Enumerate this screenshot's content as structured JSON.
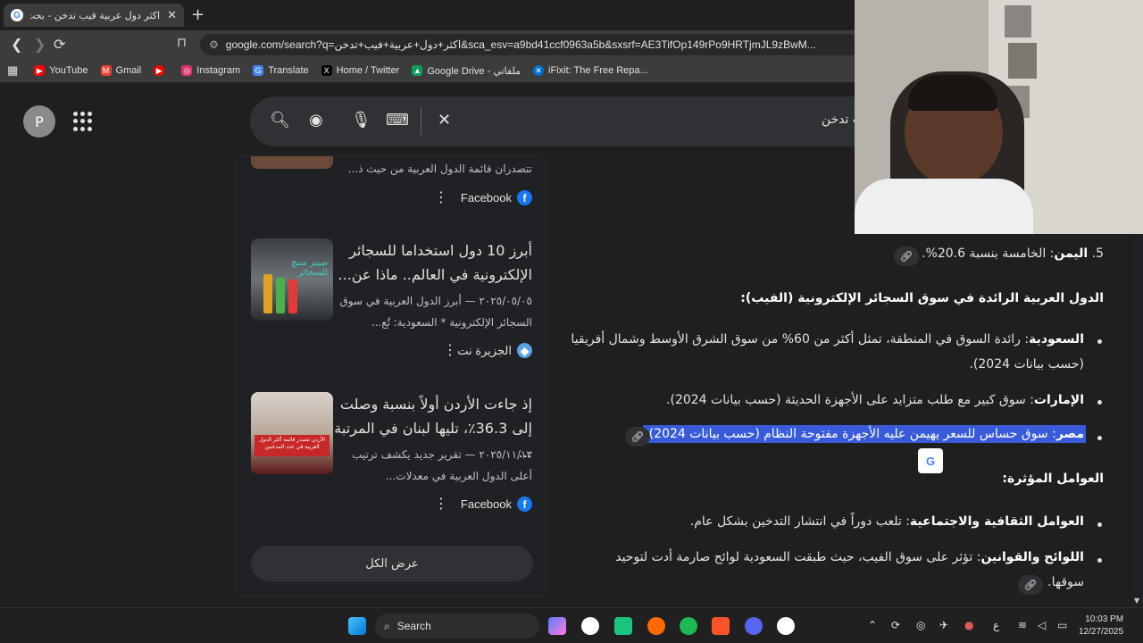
{
  "browser": {
    "tab_title": "اكثر دول عربية فيب تدخن - بحث Google",
    "address": "google.com/search?q=اكثر+دول+عربية+فيب+تدخن&sca_esv=a9bd41ccf0963a5b&sxsrf=AE3TifOp149rPo9HRTjmJL9zBwM..."
  },
  "bookmarks": [
    {
      "label": "YouTube",
      "icon": "youtube-icon",
      "color": "#ff0000"
    },
    {
      "label": "Gmail",
      "icon": "gmail-icon",
      "color": "#ea4335"
    },
    {
      "label": "",
      "icon": "youtube-music-icon",
      "color": "#ff0000"
    },
    {
      "label": "Instagram",
      "icon": "instagram-icon",
      "color": "#e1306c"
    },
    {
      "label": "Translate",
      "icon": "translate-icon",
      "color": "#4285f4"
    },
    {
      "label": "Home / Twitter",
      "icon": "x-icon",
      "color": "#000000"
    },
    {
      "label": "Google Drive - ملفاتي",
      "icon": "drive-icon",
      "color": "#0f9d58"
    },
    {
      "label": "iFixit: The Free Repa...",
      "icon": "ifixit-icon",
      "color": "#0071ce"
    }
  ],
  "google": {
    "avatar_letter": "P",
    "query": "ب تدخن"
  },
  "left_card": {
    "partial_desc": "تتصدران قائمة الدول العربية من حيث ذ...",
    "partial_source": "Facebook",
    "articles": [
      {
        "title": "أبرز 10 دول استخداما للسجائر الإلكترونية في العالم.. ماذا عن...",
        "date_desc": "٢٠٢٥/٠٥/٠٥ — أبرز الدول العربية في سوق السجائر الإلكترونية * السعودية: تُع...",
        "source": "الجزيرة نت",
        "thumb_text": "صيبز منتج للسجائر"
      },
      {
        "title": "إذ جاءت الأردن أولاً بنسبة وصلت إلى 36.3٪، تليها لبنان في المرتبة ...",
        "date_desc": "٢٠٢٥/١١/١٣ — تقرير جديد يكشف ترتيب أعلى الدول العربية في معدلات...",
        "source": "Facebook",
        "thumb_text": "الأردن تتصدر قائمة أكثر الدول العربية في عدد المدخنين"
      }
    ],
    "show_all": "عرض الكل"
  },
  "ai_overview": {
    "item5_bold": "اليمن",
    "item5_text": ": الخامسة بنسبة 20.6%.",
    "item5_num": "5.",
    "heading1": "الدول العربية الرائدة في سوق السجائر الإلكترونية (الفيب):",
    "b1_bold": "السعودية",
    "b1_text_line1": ": رائدة السوق في المنطقة، تمثل أكثر من 60% من سوق الشرق الأوسط وشمال أفريقيا",
    "b1_text_line2": "(حسب بيانات 2024).",
    "b2_bold": "الإمارات",
    "b2_text": ": سوق كبير مع طلب متزايد على الأجهزة الحديثة (حسب بيانات 2024).",
    "b3_bold": "مصر",
    "b3_text": ": سوق حساس للسعر يهيمن عليه الأجهزة مفتوحة النظام (حسب بيانات 2024).",
    "heading2": "العوامل المؤثرة:",
    "b4_bold": "العوامل الثقافية والاجتماعية",
    "b4_text": ": تلعب دوراً في انتشار التدخين بشكل عام.",
    "b5_bold": "اللوائح والقوانين",
    "b5_text": ": تؤثر على سوق الفيب، حيث طبقت السعودية لوائح صارمة أدت لتوحيد",
    "b5_text_line2": "سوقها."
  },
  "taskbar": {
    "search_label": "Search",
    "time": "10:03 PM",
    "date": "12/27/2025",
    "lang": "ع"
  }
}
